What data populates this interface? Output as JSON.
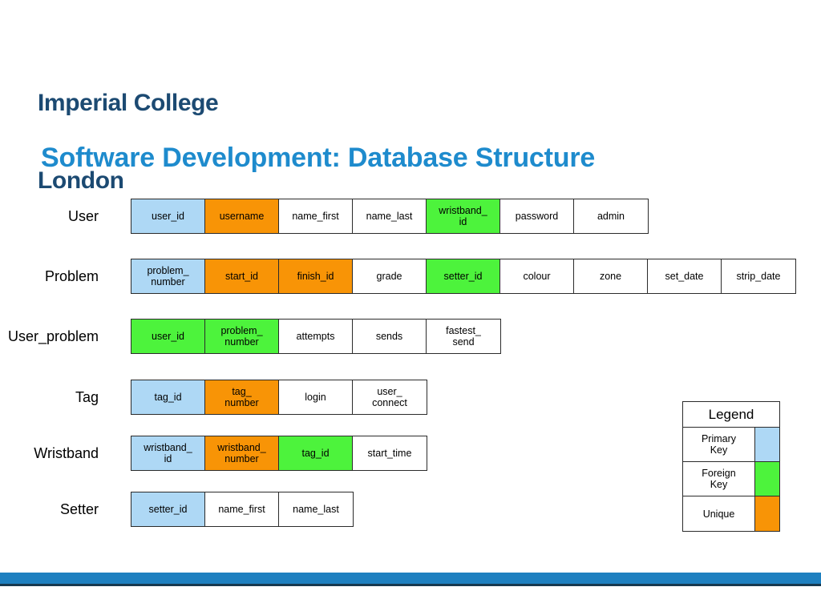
{
  "logo": {
    "line1": "Imperial College",
    "line2": "London",
    "color": "#1c4a72"
  },
  "title": {
    "text": "Software Development: Database Structure",
    "color": "#1e8bcd"
  },
  "colors": {
    "primary_key": "#aed8f5",
    "foreign_key": "#4df33c",
    "unique": "#f89406",
    "border": "#2b2b2b",
    "footer_bar": "#1e80c0",
    "footer_rule": "#17394f"
  },
  "tables": [
    {
      "name": "User",
      "columns": [
        {
          "label": "user_id",
          "key": "pk"
        },
        {
          "label": "username",
          "key": "uq"
        },
        {
          "label": "name_first",
          "key": "none"
        },
        {
          "label": "name_last",
          "key": "none"
        },
        {
          "label": "wristband_\nid",
          "key": "fk"
        },
        {
          "label": "password",
          "key": "none"
        },
        {
          "label": "admin",
          "key": "none"
        }
      ]
    },
    {
      "name": "Problem",
      "columns": [
        {
          "label": "problem_\nnumber",
          "key": "pk"
        },
        {
          "label": "start_id",
          "key": "uq"
        },
        {
          "label": "finish_id",
          "key": "uq"
        },
        {
          "label": "grade",
          "key": "none"
        },
        {
          "label": "setter_id",
          "key": "fk"
        },
        {
          "label": "colour",
          "key": "none"
        },
        {
          "label": "zone",
          "key": "none"
        },
        {
          "label": "set_date",
          "key": "none"
        },
        {
          "label": "strip_date",
          "key": "none"
        }
      ]
    },
    {
      "name": "User_problem",
      "columns": [
        {
          "label": "user_id",
          "key": "fk"
        },
        {
          "label": "problem_\nnumber",
          "key": "fk"
        },
        {
          "label": "attempts",
          "key": "none"
        },
        {
          "label": "sends",
          "key": "none"
        },
        {
          "label": "fastest_\nsend",
          "key": "none"
        }
      ]
    },
    {
      "name": "Tag",
      "columns": [
        {
          "label": "tag_id",
          "key": "pk"
        },
        {
          "label": "tag_\nnumber",
          "key": "uq"
        },
        {
          "label": "login",
          "key": "none"
        },
        {
          "label": "user_\nconnect",
          "key": "none"
        }
      ]
    },
    {
      "name": "Wristband",
      "columns": [
        {
          "label": "wristband_\nid",
          "key": "pk"
        },
        {
          "label": "wristband_\nnumber",
          "key": "uq"
        },
        {
          "label": "tag_id",
          "key": "fk"
        },
        {
          "label": "start_time",
          "key": "none"
        }
      ]
    },
    {
      "name": "Setter",
      "columns": [
        {
          "label": "setter_id",
          "key": "pk"
        },
        {
          "label": "name_first",
          "key": "none"
        },
        {
          "label": "name_last",
          "key": "none"
        }
      ]
    }
  ],
  "legend": {
    "title": "Legend",
    "rows": [
      {
        "label": "Primary\nKey",
        "key": "pk"
      },
      {
        "label": "Foreign\nKey",
        "key": "fk"
      },
      {
        "label": "Unique",
        "key": "uq"
      }
    ]
  }
}
